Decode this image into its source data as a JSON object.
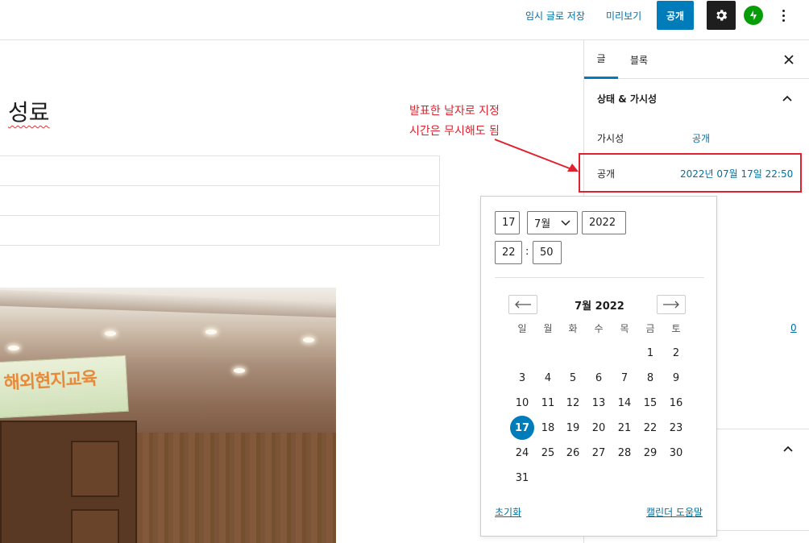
{
  "topbar": {
    "save_draft": "임시 글로 저장",
    "preview": "미리보기",
    "publish": "공개"
  },
  "editor": {
    "title_fragment": "성료"
  },
  "sidebar": {
    "tabs": [
      {
        "label": "글"
      },
      {
        "label": "블록"
      }
    ],
    "panel_title": "상태 & 가시성",
    "visibility_label": "가시성",
    "visibility_value": "공개",
    "publish_label": "공개",
    "publish_value": "2022년 07월 17일 22:50",
    "count_link": "0"
  },
  "annotation": {
    "line1": "발표한 날자로 지정",
    "line2": "시간은 무시해도 됨",
    "color": "#e0212e"
  },
  "datepicker": {
    "day": "17",
    "month": "7월",
    "year": "2022",
    "hour": "22",
    "minute": "50",
    "month_label": "7월 2022",
    "weekdays": [
      "일",
      "월",
      "화",
      "수",
      "목",
      "금",
      "토"
    ],
    "weeks": [
      [
        "",
        "",
        "",
        "",
        "",
        "1",
        "2"
      ],
      [
        "3",
        "4",
        "5",
        "6",
        "7",
        "8",
        "9"
      ],
      [
        "10",
        "11",
        "12",
        "13",
        "14",
        "15",
        "16"
      ],
      [
        "17",
        "18",
        "19",
        "20",
        "21",
        "22",
        "23"
      ],
      [
        "24",
        "25",
        "26",
        "27",
        "28",
        "29",
        "30"
      ],
      [
        "31",
        "",
        "",
        "",
        "",
        "",
        ""
      ]
    ],
    "selected_day": "17",
    "reset": "초기화",
    "help": "캘린더 도움말"
  },
  "colors": {
    "accent": "#007cba",
    "link": "#0071a1"
  }
}
